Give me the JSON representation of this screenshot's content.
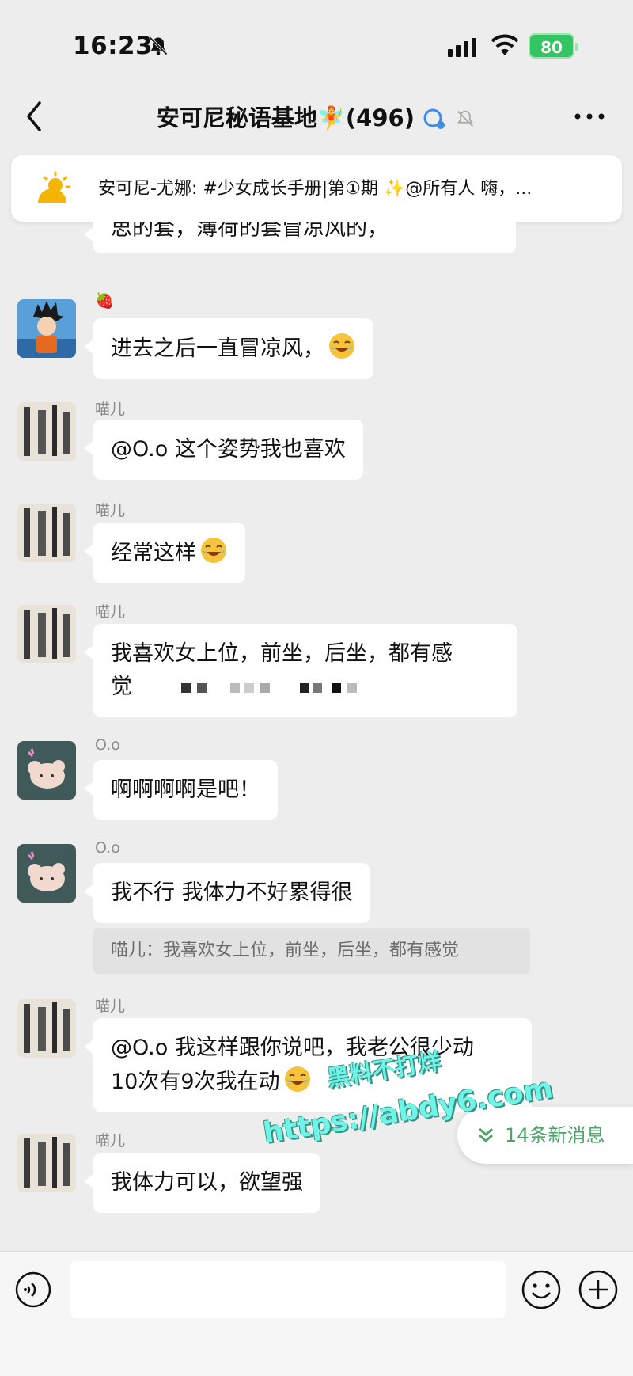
{
  "status": {
    "time": "16:23",
    "battery": "80"
  },
  "header": {
    "title": "安可尼秘语基地🧚(496)"
  },
  "pinned": {
    "text": "安可尼-尤娜: #少女成长手册|第①期 ✨@所有人  嗨，..."
  },
  "messages": [
    {
      "sender": "",
      "text": "思的套，薄荷的套冒凉风的，"
    },
    {
      "sender": "🍓",
      "text": "进去之后一直冒凉风，"
    },
    {
      "sender": "喵儿",
      "text": "@O.o 这个姿势我也喜欢"
    },
    {
      "sender": "喵儿",
      "text": "经常这样"
    },
    {
      "sender": "喵儿",
      "line1": "我喜欢女上位，前坐，后坐，都有感",
      "line2": "觉"
    },
    {
      "sender": "O.o",
      "text": "啊啊啊啊是吧！"
    },
    {
      "sender": "O.o",
      "text": "我不行 我体力不好累得很",
      "quote": "喵儿：我喜欢女上位，前坐，后坐，都有感觉"
    },
    {
      "sender": "喵儿",
      "line1": "@O.o 我这样跟你说吧，我老公很少动",
      "line2": "10次有9次我在动"
    },
    {
      "sender": "喵儿",
      "text": "我体力可以，欲望强"
    }
  ],
  "new_messages": {
    "label": "14条新消息"
  },
  "watermark": {
    "line1": "黑料不打烊",
    "line2": "https://abdy6.com"
  },
  "colors": {
    "background": "#ededed",
    "accent_green": "#4fa46a",
    "battery_green": "#33c463"
  },
  "icons": [
    "bell-off-icon",
    "signal-icon",
    "wifi-icon",
    "back-icon",
    "more-icon",
    "sun-icon",
    "voice-icon",
    "emoji-icon",
    "plus-icon",
    "double-chevron-down-icon"
  ]
}
